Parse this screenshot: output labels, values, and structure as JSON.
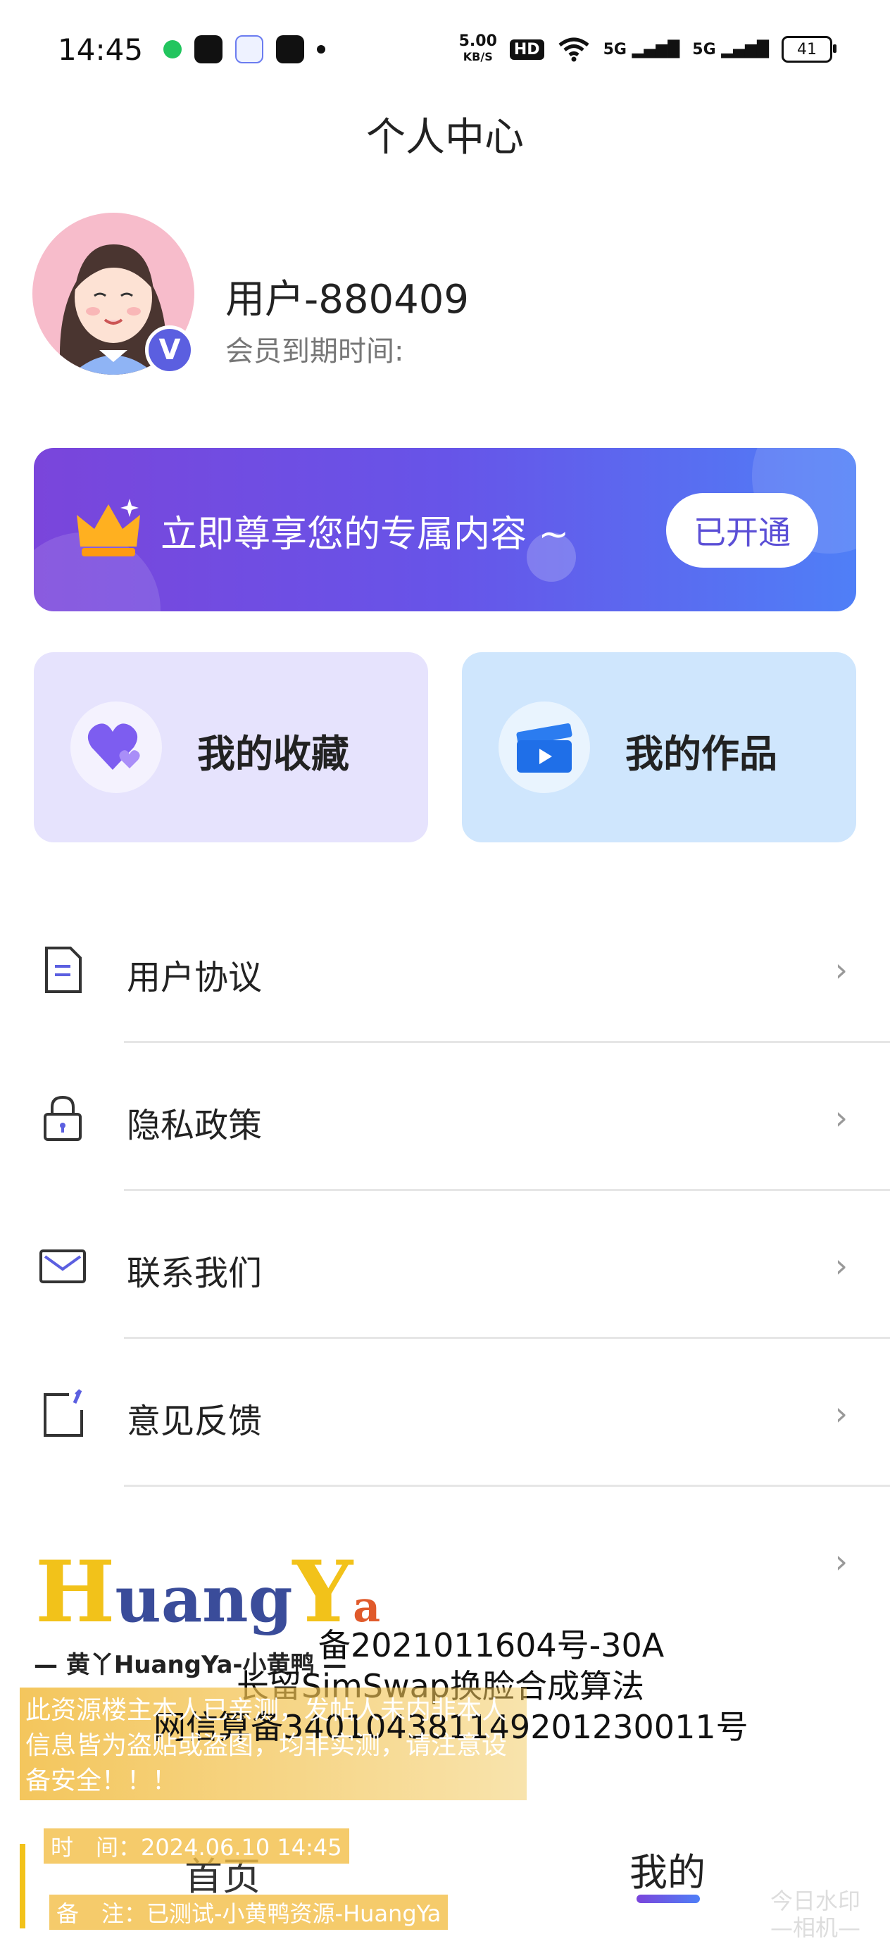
{
  "status_bar": {
    "time": "14:45",
    "net_speed_value": "5.00",
    "net_speed_unit": "KB/S",
    "hd_label": "HD",
    "signal1": "5G",
    "signal2": "5G",
    "battery": "41"
  },
  "header": {
    "title": "个人中心"
  },
  "profile": {
    "username": "用户-880409",
    "expiry_label": "会员到期时间:",
    "badge": "V"
  },
  "vip_banner": {
    "text": "立即尊享您的专属内容 ~",
    "button_label": "已开通",
    "colors": {
      "start": "#7a45db",
      "end": "#4f7ff7"
    }
  },
  "cards": {
    "favorites_label": "我的收藏",
    "works_label": "我的作品"
  },
  "menu": {
    "items": [
      {
        "label": "用户协议",
        "icon": "document-icon"
      },
      {
        "label": "隐私政策",
        "icon": "lock-icon"
      },
      {
        "label": "联系我们",
        "icon": "mail-icon"
      },
      {
        "label": "意见反馈",
        "icon": "feedback-icon"
      }
    ]
  },
  "bottom_nav": {
    "home_label": "首页",
    "mine_label": "我的",
    "active": "我的"
  },
  "watermark": {
    "logo_h": "H",
    "logo_uang": "uang",
    "logo_y": "Y",
    "logo_a": "a",
    "brand": "— 黄丫HuangYa-小黄鸭 —",
    "record1": "备2021011604号-30A",
    "record2": "长留SimSwap换脸合成算法",
    "record3": "网信算备340104381149201230011号",
    "notice": "此资源楼主本人已亲测，发帖人未内非本人信息皆为盗贴或盗图，均非实测，请注意设备安全！！！",
    "time": "时　间：2024.06.10 14:45",
    "note": "备　注：已测试-小黄鸭资源-HuangYa",
    "camera_line1": "今日水印",
    "camera_line2": "—相机—"
  }
}
